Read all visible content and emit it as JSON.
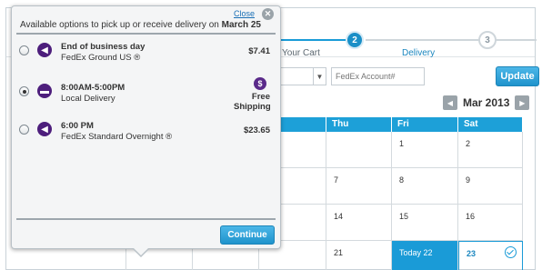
{
  "steps": [
    {
      "number": "",
      "label": "Your Cart",
      "state": "done"
    },
    {
      "number": "2",
      "label": "Delivery",
      "state": "active"
    },
    {
      "number": "3",
      "label": "",
      "state": "todo"
    }
  ],
  "toolbar": {
    "fedex_account_placeholder": "FedEx Account#",
    "update_label": "Update"
  },
  "calendar": {
    "month_label": "Mar 2013",
    "visible_headers": [
      "Thu",
      "Fri",
      "Sat"
    ],
    "rows": [
      {
        "thu": "",
        "fri": "1",
        "sat": "2"
      },
      {
        "thu": "7",
        "fri": "8",
        "sat": "9"
      },
      {
        "thu": "14",
        "fri": "15",
        "sat": "16"
      },
      {
        "thu": "21",
        "fri": "Today 22",
        "sat": "23"
      }
    ]
  },
  "popup": {
    "close_label": "Close",
    "title_prefix": "Available options to pick up or receive delivery on",
    "title_date": "March 25",
    "options": [
      {
        "time": "End of business day",
        "service": "FedEx Ground US ®",
        "price": "$7.41",
        "selected": false
      },
      {
        "time": "8:00AM-5:00PM",
        "service": "Local Delivery",
        "price": "Free Shipping",
        "selected": true
      },
      {
        "time": "6:00 PM",
        "service": "FedEx Standard Overnight ®",
        "price": "$23.65",
        "selected": false
      }
    ],
    "continue_label": "Continue"
  },
  "colors": {
    "accent": "#1a9bd7",
    "carrier_purple": "#4d1e7c"
  },
  "icons": {
    "carrier": "fedex-arrow-icon",
    "local": "truck-icon",
    "free": "dollar-icon",
    "close": "close-icon",
    "check": "check-circle-icon"
  }
}
